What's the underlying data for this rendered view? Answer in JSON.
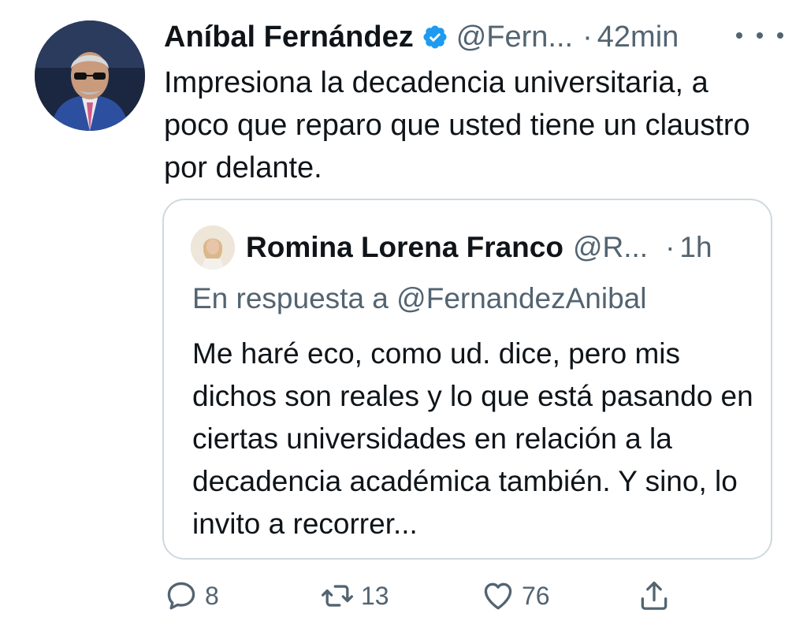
{
  "tweet": {
    "author_name": "Aníbal Fernández",
    "handle": "@Fern...",
    "separator": "·",
    "time": "42min",
    "text": "Impresiona la decadencia universitaria, a poco que reparo que usted tiene un claustro por delante.",
    "avatar_icon": "avatar-photo",
    "verified_icon": "verified-badge-icon",
    "more_icon": "more-options-icon"
  },
  "quoted": {
    "author_name": "Romina Lorena Franco",
    "handle": "@R...",
    "separator": "·",
    "time": "1h",
    "reply_to": "En respuesta a @FernandezAnibal",
    "text": "Me haré eco, como ud. dice, pero mis dichos son reales y lo que está pasando en ciertas universidades en relación a la decadencia académica también. Y sino, lo invito a recorrer..."
  },
  "actions": {
    "reply_count": "8",
    "retweet_count": "13",
    "like_count": "76"
  },
  "colors": {
    "text": "#0f1419",
    "secondary": "#536471",
    "verified": "#1d9bf0",
    "border": "#cfd9de"
  }
}
